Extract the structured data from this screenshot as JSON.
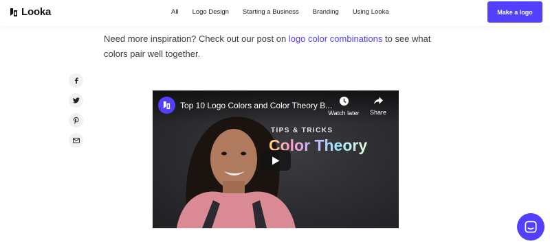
{
  "header": {
    "brand": "Looka",
    "nav": [
      "All",
      "Logo Design",
      "Starting a Business",
      "Branding",
      "Using Looka"
    ],
    "cta_label": "Make a logo"
  },
  "article": {
    "text_before_link": "Need more inspiration? Check out our post on ",
    "link_text": "logo color combinations",
    "text_after_link": " to see what colors pair well together."
  },
  "share": {
    "items": [
      "facebook-icon",
      "twitter-icon",
      "pinterest-icon",
      "mail-icon"
    ]
  },
  "video": {
    "title": "Top 10 Logo Colors and Color Theory B...",
    "watch_later": "Watch later",
    "share": "Share",
    "overlay_kicker": "TIPS & TRICKS",
    "overlay_title": "Color Theory"
  },
  "colors": {
    "accent": "#5340ff",
    "text": "#3a3a44"
  }
}
